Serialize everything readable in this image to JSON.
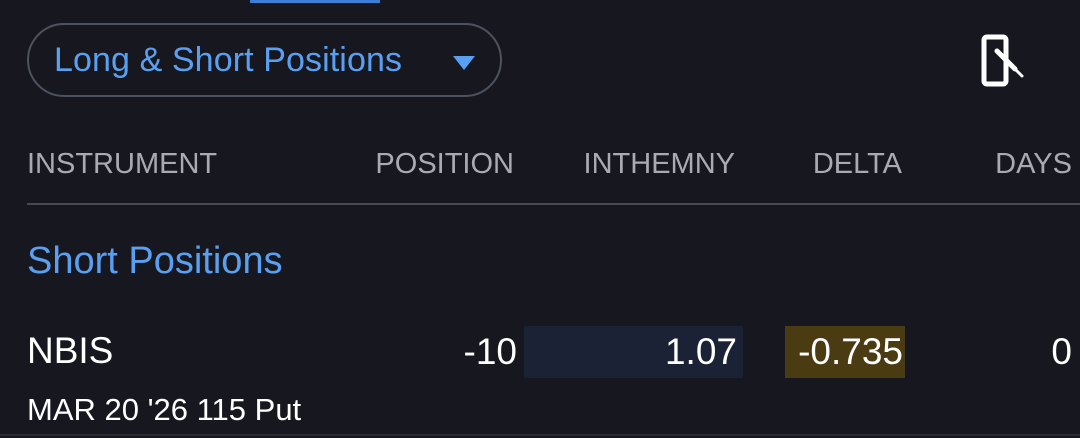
{
  "filter": {
    "label": "Long & Short Positions"
  },
  "icons": {
    "dropdown": "caret-down-icon",
    "rotate": "screen-rotation-icon"
  },
  "columns": {
    "instrument": "INSTRUMENT",
    "position": "POSITION",
    "inthemny": "INTHEMNY",
    "delta": "DELTA",
    "days": "DAYS"
  },
  "section": {
    "title": "Short Positions"
  },
  "rows": [
    {
      "symbol": "NBIS",
      "contract": "MAR 20 '26 115 Put",
      "position": "-10",
      "inthemny": "1.07",
      "delta": "-0.735",
      "days": "0"
    }
  ],
  "colors": {
    "background": "#17181f",
    "accent": "#5aa0f2",
    "itm_highlight": "#1c2236",
    "delta_highlight": "#4a3b13"
  }
}
